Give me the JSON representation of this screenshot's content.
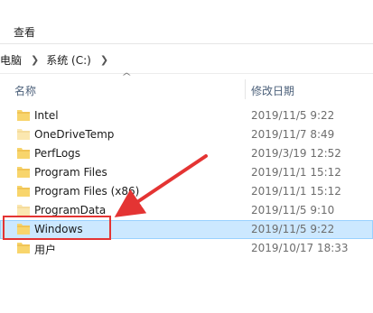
{
  "menu": {
    "view_label": "查看"
  },
  "address": {
    "crumbs": [
      "电脑",
      "系统 (C:)"
    ]
  },
  "columns": {
    "name_label": "名称",
    "date_label": "修改日期"
  },
  "files": [
    {
      "name": "Intel",
      "date": "2019/11/5 9:22",
      "selected": false
    },
    {
      "name": "OneDriveTemp",
      "date": "2019/11/7 8:49",
      "selected": false
    },
    {
      "name": "PerfLogs",
      "date": "2019/3/19 12:52",
      "selected": false
    },
    {
      "name": "Program Files",
      "date": "2019/11/1 15:12",
      "selected": false
    },
    {
      "name": "Program Files (x86)",
      "date": "2019/11/1 15:12",
      "selected": false
    },
    {
      "name": "ProgramData",
      "date": "2019/11/5 9:10",
      "selected": false
    },
    {
      "name": "Windows",
      "date": "2019/11/5 9:22",
      "selected": true
    },
    {
      "name": "用户",
      "date": "2019/10/17 18:33",
      "selected": false
    }
  ],
  "colors": {
    "folder": "#f8d56c",
    "folder_dark": "#e7b43f",
    "selection": "#cce8ff",
    "annotation": "#e43433"
  },
  "icons": {
    "folder": "folder-icon",
    "breadcrumb_separator": "chevron-right-icon",
    "sort": "chevron-up-icon"
  }
}
